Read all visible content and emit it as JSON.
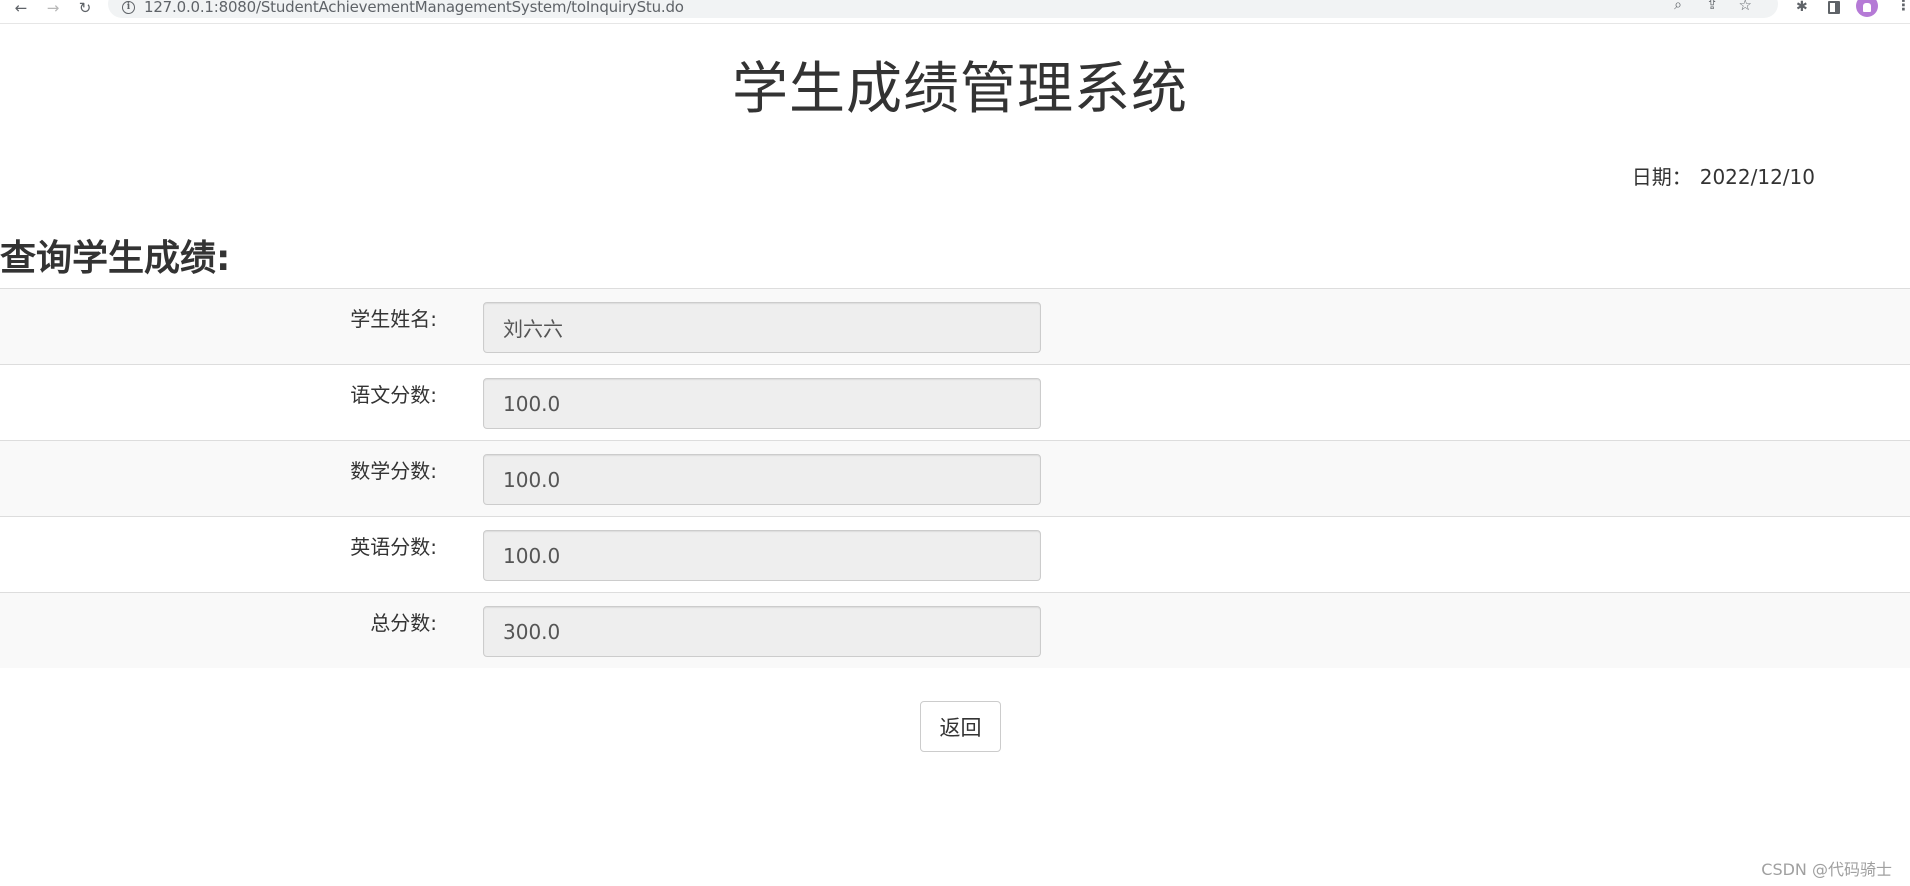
{
  "browser": {
    "url": "127.0.0.1:8080/StudentAchievementManagementSystem/toInquiryStu.do"
  },
  "page": {
    "title": "学生成绩管理系统",
    "date_label": "日期：",
    "date_value": "2022/12/10",
    "section_title": "查询学生成绩:"
  },
  "form": {
    "fields": [
      {
        "label": "学生姓名:",
        "value": "刘六六"
      },
      {
        "label": "语文分数:",
        "value": "100.0"
      },
      {
        "label": "数学分数:",
        "value": "100.0"
      },
      {
        "label": "英语分数:",
        "value": "100.0"
      },
      {
        "label": "总分数:",
        "value": "300.0"
      }
    ],
    "back_label": "返回"
  },
  "watermark": "CSDN @代码骑士",
  "colors": {
    "text": "#333333",
    "input_bg": "#eeeeee",
    "input_border": "#cccccc",
    "stripe": "#f9f9f9",
    "avatar": "#b57ad6"
  },
  "icons": [
    "back-arrow-icon",
    "forward-arrow-icon",
    "reload-icon",
    "info-icon",
    "zoom-icon",
    "share-icon",
    "star-icon",
    "extensions-icon",
    "side-panel-icon",
    "profile-avatar",
    "menu-icon"
  ]
}
